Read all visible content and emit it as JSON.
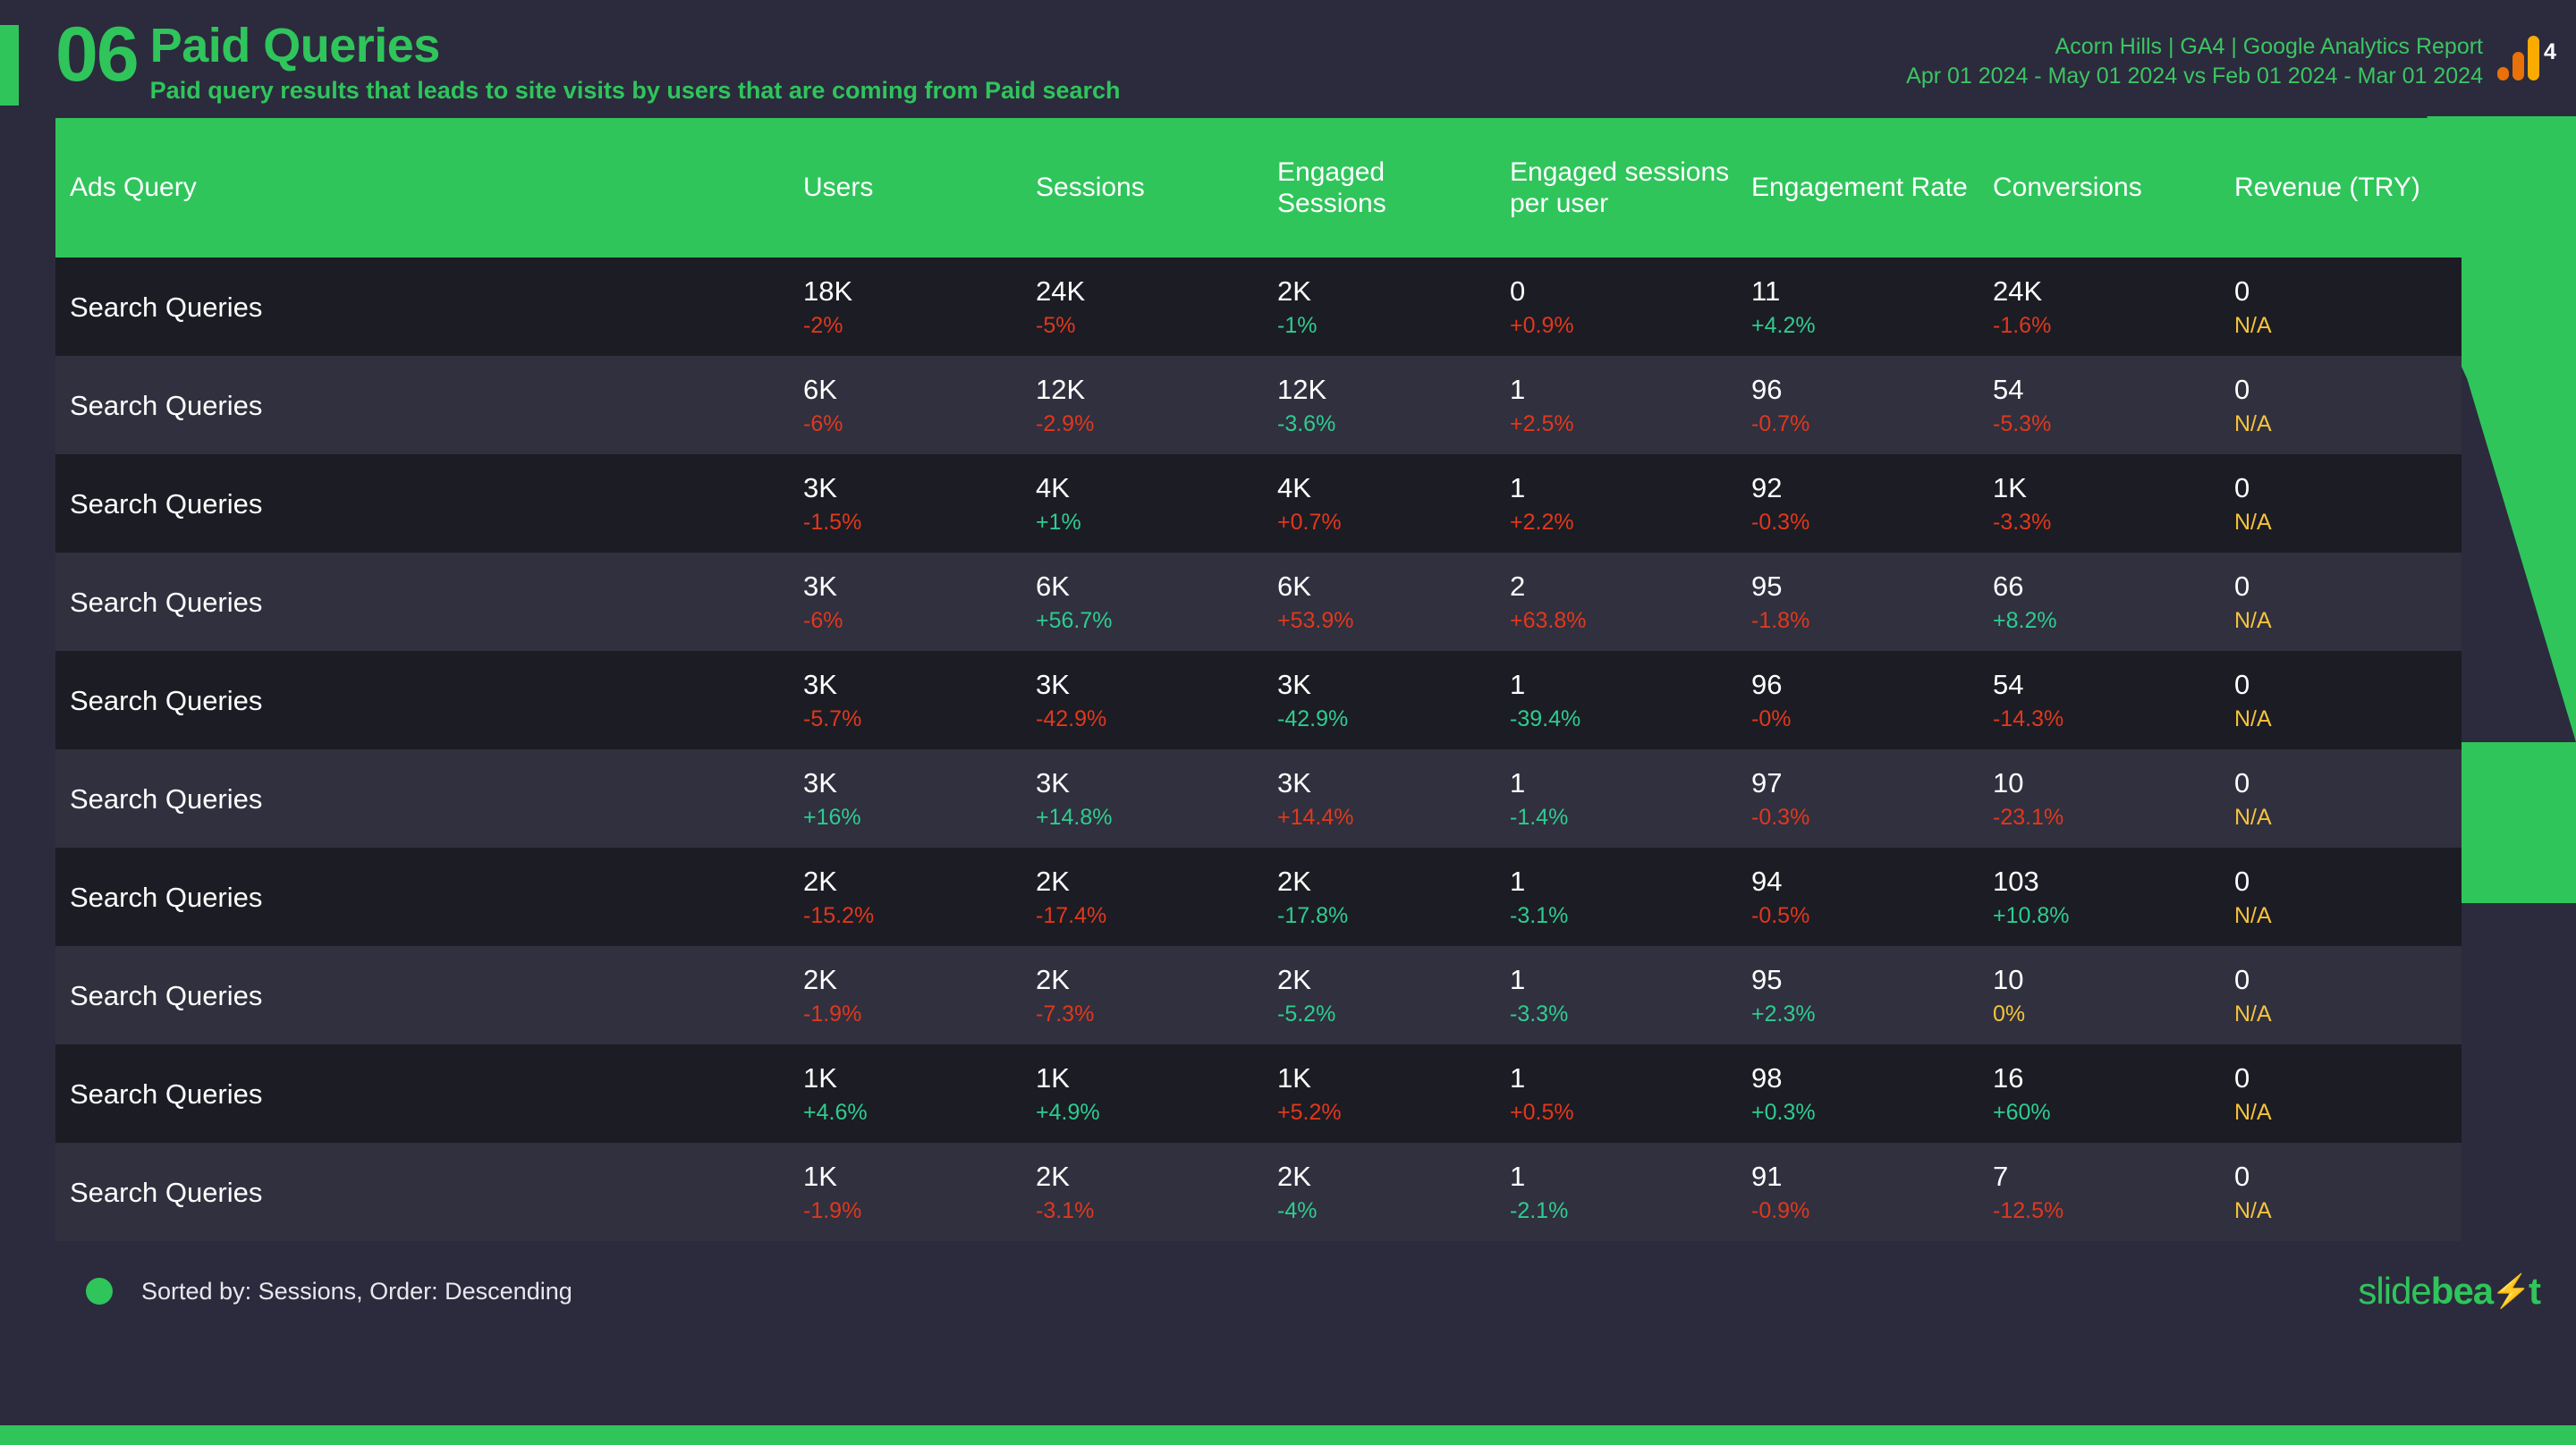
{
  "header": {
    "section_number": "06",
    "title": "Paid Queries",
    "subtitle": "Paid query results that leads to site visits by users that are coming from Paid search",
    "report_name": "Acorn Hills | GA4 | Google Analytics Report",
    "date_range": "Apr 01 2024 - May 01 2024 vs Feb 01 2024 - Mar 01 2024",
    "logo_badge": "4"
  },
  "table": {
    "columns": [
      "Ads Query",
      "Users",
      "Sessions",
      "Engaged Sessions",
      "Engaged sessions per user",
      "Engagement Rate",
      "Conversions",
      "Revenue (TRY)"
    ],
    "rows": [
      {
        "query": "Search Queries",
        "cells": [
          {
            "value": "18K",
            "delta": "-2%",
            "dir": "down"
          },
          {
            "value": "24K",
            "delta": "-5%",
            "dir": "down"
          },
          {
            "value": "2K",
            "delta": "-1%",
            "dir": "up"
          },
          {
            "value": "0",
            "delta": "+0.9%",
            "dir": "down"
          },
          {
            "value": "11",
            "delta": "+4.2%",
            "dir": "up"
          },
          {
            "value": "24K",
            "delta": "-1.6%",
            "dir": "down"
          },
          {
            "value": "0",
            "delta": "N/A",
            "dir": "na"
          }
        ]
      },
      {
        "query": "Search Queries",
        "cells": [
          {
            "value": "6K",
            "delta": "-6%",
            "dir": "down"
          },
          {
            "value": "12K",
            "delta": "-2.9%",
            "dir": "down"
          },
          {
            "value": "12K",
            "delta": "-3.6%",
            "dir": "up"
          },
          {
            "value": "1",
            "delta": "+2.5%",
            "dir": "down"
          },
          {
            "value": "96",
            "delta": "-0.7%",
            "dir": "down"
          },
          {
            "value": "54",
            "delta": "-5.3%",
            "dir": "down"
          },
          {
            "value": "0",
            "delta": "N/A",
            "dir": "na"
          }
        ]
      },
      {
        "query": "Search Queries",
        "cells": [
          {
            "value": "3K",
            "delta": "-1.5%",
            "dir": "down"
          },
          {
            "value": "4K",
            "delta": "+1%",
            "dir": "up"
          },
          {
            "value": "4K",
            "delta": "+0.7%",
            "dir": "down"
          },
          {
            "value": "1",
            "delta": "+2.2%",
            "dir": "down"
          },
          {
            "value": "92",
            "delta": "-0.3%",
            "dir": "down"
          },
          {
            "value": "1K",
            "delta": "-3.3%",
            "dir": "down"
          },
          {
            "value": "0",
            "delta": "N/A",
            "dir": "na"
          }
        ]
      },
      {
        "query": "Search Queries",
        "cells": [
          {
            "value": "3K",
            "delta": "-6%",
            "dir": "down"
          },
          {
            "value": "6K",
            "delta": "+56.7%",
            "dir": "up"
          },
          {
            "value": "6K",
            "delta": "+53.9%",
            "dir": "down"
          },
          {
            "value": "2",
            "delta": "+63.8%",
            "dir": "down"
          },
          {
            "value": "95",
            "delta": "-1.8%",
            "dir": "down"
          },
          {
            "value": "66",
            "delta": "+8.2%",
            "dir": "up"
          },
          {
            "value": "0",
            "delta": "N/A",
            "dir": "na"
          }
        ]
      },
      {
        "query": "Search Queries",
        "cells": [
          {
            "value": "3K",
            "delta": "-5.7%",
            "dir": "down"
          },
          {
            "value": "3K",
            "delta": "-42.9%",
            "dir": "down"
          },
          {
            "value": "3K",
            "delta": "-42.9%",
            "dir": "up"
          },
          {
            "value": "1",
            "delta": "-39.4%",
            "dir": "up"
          },
          {
            "value": "96",
            "delta": "-0%",
            "dir": "down"
          },
          {
            "value": "54",
            "delta": "-14.3%",
            "dir": "down"
          },
          {
            "value": "0",
            "delta": "N/A",
            "dir": "na"
          }
        ]
      },
      {
        "query": "Search Queries",
        "cells": [
          {
            "value": "3K",
            "delta": "+16%",
            "dir": "up"
          },
          {
            "value": "3K",
            "delta": "+14.8%",
            "dir": "up"
          },
          {
            "value": "3K",
            "delta": "+14.4%",
            "dir": "down"
          },
          {
            "value": "1",
            "delta": "-1.4%",
            "dir": "up"
          },
          {
            "value": "97",
            "delta": "-0.3%",
            "dir": "down"
          },
          {
            "value": "10",
            "delta": "-23.1%",
            "dir": "down"
          },
          {
            "value": "0",
            "delta": "N/A",
            "dir": "na"
          }
        ]
      },
      {
        "query": "Search Queries",
        "cells": [
          {
            "value": "2K",
            "delta": "-15.2%",
            "dir": "down"
          },
          {
            "value": "2K",
            "delta": "-17.4%",
            "dir": "down"
          },
          {
            "value": "2K",
            "delta": "-17.8%",
            "dir": "up"
          },
          {
            "value": "1",
            "delta": "-3.1%",
            "dir": "up"
          },
          {
            "value": "94",
            "delta": "-0.5%",
            "dir": "down"
          },
          {
            "value": "103",
            "delta": "+10.8%",
            "dir": "up"
          },
          {
            "value": "0",
            "delta": "N/A",
            "dir": "na"
          }
        ]
      },
      {
        "query": "Search Queries",
        "cells": [
          {
            "value": "2K",
            "delta": "-1.9%",
            "dir": "down"
          },
          {
            "value": "2K",
            "delta": "-7.3%",
            "dir": "down"
          },
          {
            "value": "2K",
            "delta": "-5.2%",
            "dir": "up"
          },
          {
            "value": "1",
            "delta": "-3.3%",
            "dir": "up"
          },
          {
            "value": "95",
            "delta": "+2.3%",
            "dir": "up"
          },
          {
            "value": "10",
            "delta": "0%",
            "dir": "na"
          },
          {
            "value": "0",
            "delta": "N/A",
            "dir": "na"
          }
        ]
      },
      {
        "query": "Search Queries",
        "cells": [
          {
            "value": "1K",
            "delta": "+4.6%",
            "dir": "up"
          },
          {
            "value": "1K",
            "delta": "+4.9%",
            "dir": "up"
          },
          {
            "value": "1K",
            "delta": "+5.2%",
            "dir": "down"
          },
          {
            "value": "1",
            "delta": "+0.5%",
            "dir": "down"
          },
          {
            "value": "98",
            "delta": "+0.3%",
            "dir": "up"
          },
          {
            "value": "16",
            "delta": "+60%",
            "dir": "up"
          },
          {
            "value": "0",
            "delta": "N/A",
            "dir": "na"
          }
        ]
      },
      {
        "query": "Search Queries",
        "cells": [
          {
            "value": "1K",
            "delta": "-1.9%",
            "dir": "down"
          },
          {
            "value": "2K",
            "delta": "-3.1%",
            "dir": "down"
          },
          {
            "value": "2K",
            "delta": "-4%",
            "dir": "up"
          },
          {
            "value": "1",
            "delta": "-2.1%",
            "dir": "up"
          },
          {
            "value": "91",
            "delta": "-0.9%",
            "dir": "down"
          },
          {
            "value": "7",
            "delta": "-12.5%",
            "dir": "down"
          },
          {
            "value": "0",
            "delta": "N/A",
            "dir": "na"
          }
        ]
      }
    ]
  },
  "footer": {
    "sort_note": "Sorted by: Sessions, Order: Descending",
    "brand_light": "slide",
    "brand_bold": "bea",
    "brand_bolt": "⚡",
    "brand_tail": "t"
  },
  "colors": {
    "accent_green": "#2fc55b",
    "up_green": "#2ecc8f",
    "down_red": "#e0381c",
    "na_yellow": "#f5c33b",
    "bg": "#2b2b3d",
    "row_odd": "#1c1c24",
    "row_even": "#30303f"
  }
}
